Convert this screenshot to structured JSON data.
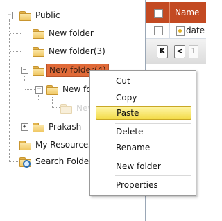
{
  "tree": {
    "expander_expanded": "−",
    "expander_collapsed": "+",
    "items": [
      {
        "label": "Public"
      },
      {
        "label": "New folder"
      },
      {
        "label": "New folder(3)"
      },
      {
        "label": "New folder(4)"
      },
      {
        "label": "New fol"
      },
      {
        "label": "New"
      },
      {
        "label": "Prakash"
      },
      {
        "label": "My Resources"
      },
      {
        "label": "Search Folders"
      }
    ]
  },
  "grid": {
    "header_name": "Name",
    "rows": [
      {
        "name": "date"
      }
    ],
    "pager": {
      "first": "K",
      "prev": "<",
      "page": "1"
    }
  },
  "context_menu": {
    "items": [
      "Cut",
      "Copy",
      "Paste",
      "Delete",
      "Rename",
      "New folder",
      "Properties"
    ],
    "highlighted": "Paste"
  },
  "colors": {
    "selected_folder": "#e06a38",
    "header": "#c34a22",
    "menu_highlight": "#f3db48"
  }
}
